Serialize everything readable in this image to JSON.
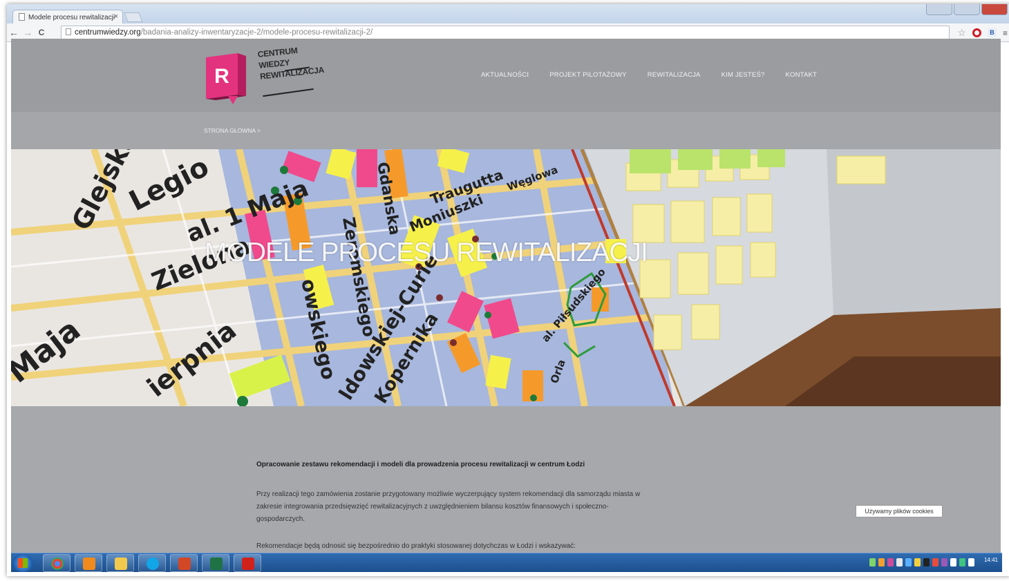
{
  "browser": {
    "tab_title": "Modele procesu rewitalizacji",
    "tab_close": "×",
    "url_host": "centrumwiedzy.org",
    "url_path": "/badania-analizy-inwentaryzacje-2/modele-procesu-rewitalizacji-2/",
    "back": "←",
    "forward": "→",
    "reload": "C",
    "bookmark_icon": "star-icon",
    "ext_label": "B"
  },
  "site": {
    "logo_letter": "R",
    "logo_lines": [
      "CENTRUM",
      "WIEDZY",
      "REWITALIZACJA"
    ],
    "nav": [
      "AKTUALNOŚCI",
      "PROJEKT PILOTAŻOWY",
      "REWITALIZACJA",
      "KIM JESTEŚ?",
      "KONTAKT"
    ],
    "breadcrumb": "STRONA GŁÓWNA >",
    "hero_title": "MODELE PROCESU REWITALIZACJI"
  },
  "content": {
    "heading": "Opracowanie zestawu rekomendacji i modeli dla prowadzenia procesu rewitalizacji w centrum Łodzi",
    "paragraphs": [
      "Przy realizacji tego zamówienia zostanie przygotowany możliwie wyczerpujący system rekomendacji dla samorządu miasta w zakresie integrowania przedsięwzięć rewitalizacyjnych z uwzględnieniem bilansu kosztów finansowych i społeczno-gospodarczych.",
      "Rekomendacje będą odnosić się bezpośrednio do praktyki stosowanej dotychczas w Łodzi i wskazywać:"
    ]
  },
  "cookie_notice": "Używamy plików cookies",
  "taskbar": {
    "clock_time": "14:41"
  },
  "colors": {
    "brand_pink": "#e4337e",
    "header_gray": "#9a9c9f",
    "page_gray": "#a6a8ab"
  }
}
